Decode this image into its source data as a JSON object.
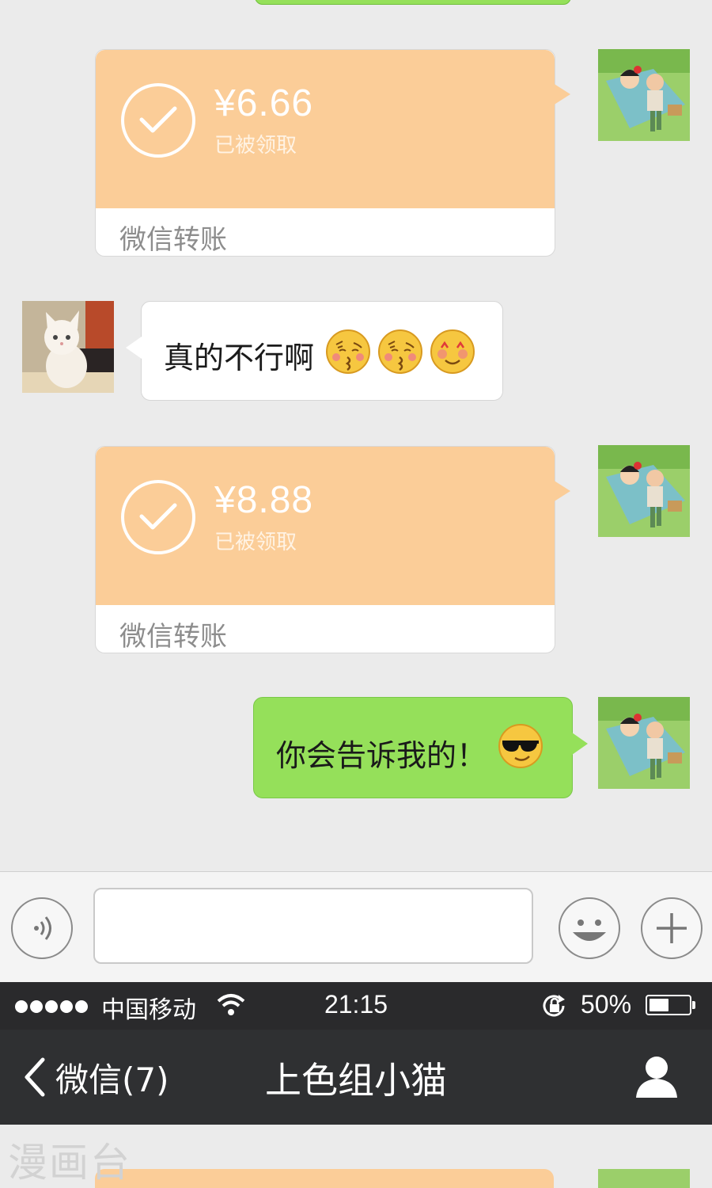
{
  "chat": {
    "messages": [
      {
        "type": "transfer",
        "direction": "out",
        "amount": "¥6.66",
        "status": "已被领取",
        "label": "微信转账"
      },
      {
        "type": "text",
        "direction": "in",
        "text": "真的不行啊",
        "emojis": [
          "kissing-face-icon",
          "kissing-face-icon",
          "smiling-face-with-heart-eyes-icon"
        ]
      },
      {
        "type": "transfer",
        "direction": "out",
        "amount": "¥8.88",
        "status": "已被领取",
        "label": "微信转账"
      },
      {
        "type": "text",
        "direction": "out",
        "text": "你会告诉我的！",
        "emojis": [
          "sunglasses-face-icon"
        ]
      }
    ]
  },
  "input_bar": {
    "voice_icon": "voice-icon",
    "emoji_icon": "emoji-face-icon",
    "plus_icon": "plus-icon",
    "placeholder": ""
  },
  "status_bar": {
    "carrier": "中国移动",
    "time": "21:15",
    "battery_pct": "50%",
    "battery_level": 0.5
  },
  "nav": {
    "back_label": "微信(7)",
    "title": "上色组小猫",
    "profile_icon": "person-icon"
  },
  "watermark": "漫画台",
  "colors": {
    "chat_bg": "#ebebeb",
    "transfer_card": "#fbcd98",
    "out_bubble": "#95e05a",
    "nav_bg": "#2f3032",
    "status_bg": "#2a2a2c"
  }
}
